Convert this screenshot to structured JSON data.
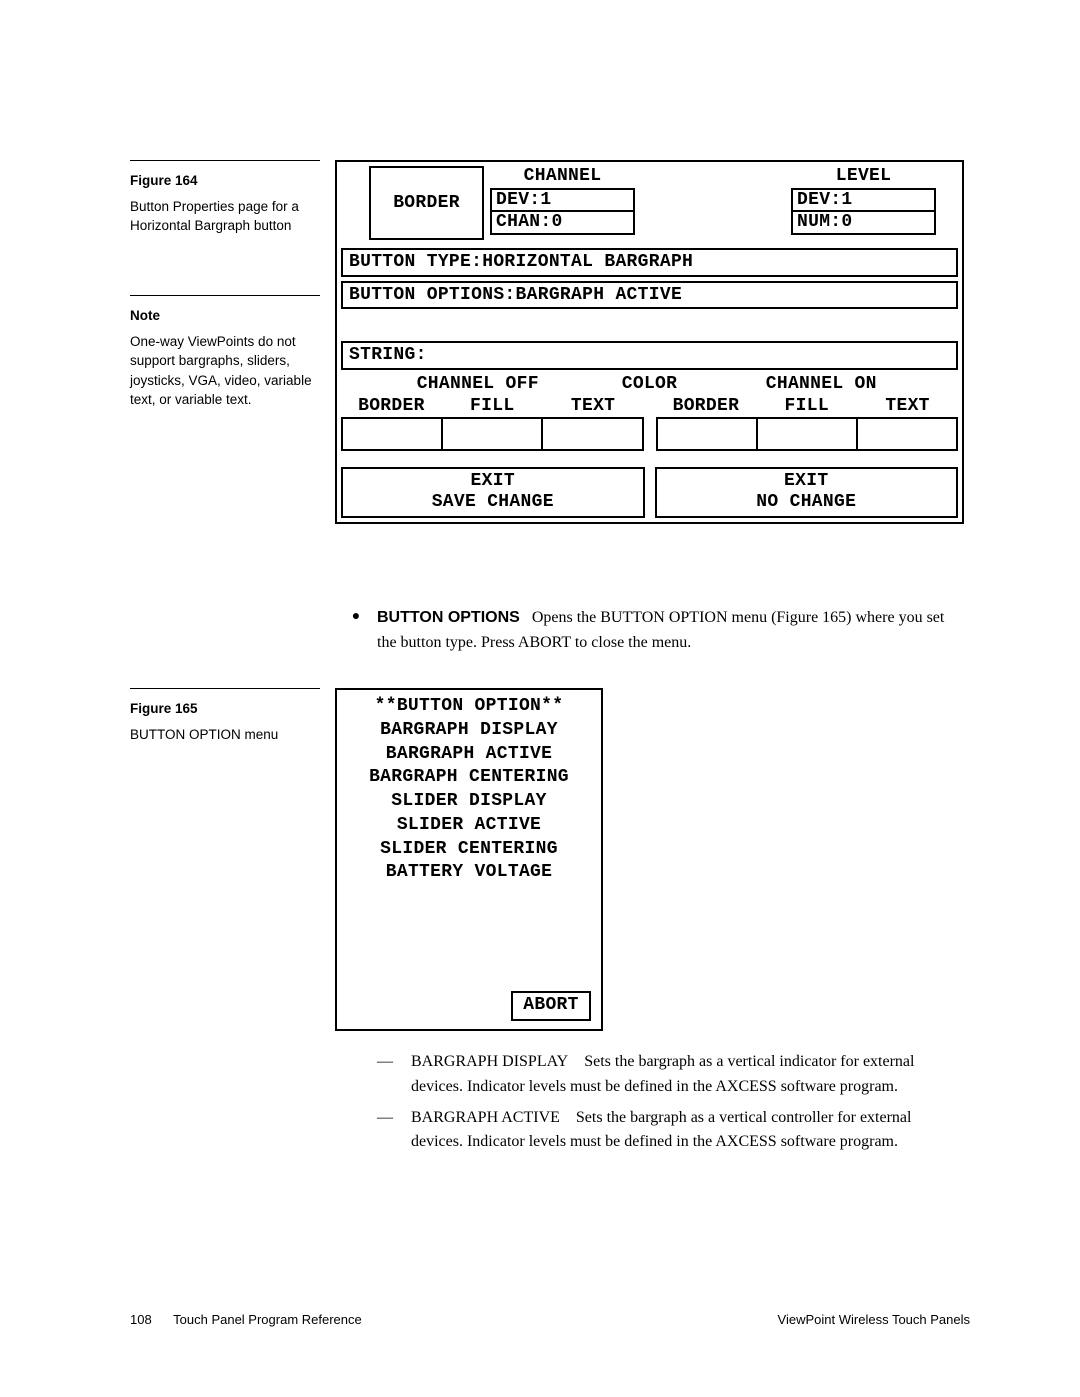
{
  "sidebar164": {
    "label": "Figure 164",
    "text": "Button Properties page for a Horizontal Bargraph button"
  },
  "noteBlock": {
    "label": "Note",
    "text": "One-way ViewPoints do not support bargraphs, sliders, joysticks, VGA, video, variable text, or variable text."
  },
  "sidebar165": {
    "label": "Figure 165",
    "text": "BUTTON OPTION menu"
  },
  "panel164": {
    "border": "BORDER",
    "channel_label": "CHANNEL",
    "channel_dev": "DEV:1",
    "channel_chan": "CHAN:0",
    "level_label": "LEVEL",
    "level_dev": "DEV:1",
    "level_num": "NUM:0",
    "button_type": "BUTTON TYPE:HORIZONTAL BARGRAPH",
    "button_options": "BUTTON OPTIONS:BARGRAPH ACTIVE",
    "string": "STRING:",
    "channel_off": "CHANNEL OFF",
    "color": "COLOR",
    "channel_on": "CHANNEL ON",
    "hdr_border": "BORDER",
    "hdr_fill": "FILL",
    "hdr_text": "TEXT",
    "exit_save1": "EXIT",
    "exit_save2": "SAVE CHANGE",
    "exit_no1": "EXIT",
    "exit_no2": "NO CHANGE"
  },
  "bullet": {
    "lead": "BUTTON OPTIONS",
    "body": "   Opens the BUTTON OPTION menu (Figure 165) where you set the button type. Press ABORT to close the menu."
  },
  "panel165": {
    "title": "**BUTTON OPTION**",
    "items": [
      "BARGRAPH DISPLAY",
      "BARGRAPH ACTIVE",
      "BARGRAPH CENTERING",
      "SLIDER DISPLAY",
      "SLIDER ACTIVE",
      "SLIDER CENTERING",
      "BATTERY VOLTAGE"
    ],
    "abort": "ABORT"
  },
  "dash1": {
    "lead": "BARGRAPH DISPLAY",
    "body": "    Sets the bargraph as a vertical indicator for external devices. Indicator levels must be defined in the AXCESS software program."
  },
  "dash2": {
    "lead": "BARGRAPH ACTIVE",
    "body": "    Sets the bargraph as a vertical controller for external devices. Indicator levels must be defined in the AXCESS software program."
  },
  "footer": {
    "page": "108",
    "center": "Touch Panel Program Reference",
    "right": "ViewPoint Wireless Touch Panels"
  }
}
